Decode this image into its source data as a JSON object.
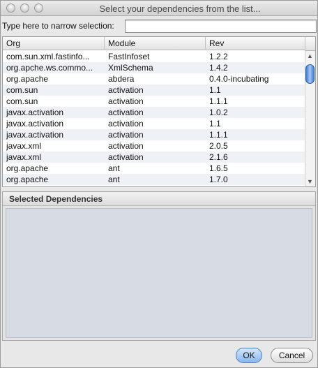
{
  "window": {
    "title": "Select your dependencies from the list..."
  },
  "filter": {
    "label": "Type here to narrow selection:",
    "value": "",
    "placeholder": ""
  },
  "table": {
    "columns": [
      "Org",
      "Module",
      "Rev"
    ],
    "rows": [
      [
        "com.sun.xml.fastinfo...",
        "FastInfoset",
        "1.2.2"
      ],
      [
        "org.apche.ws.commo...",
        "XmlSchema",
        "1.4.2"
      ],
      [
        "org.apache",
        "abdera",
        "0.4.0-incubating"
      ],
      [
        "com.sun",
        "activation",
        "1.1"
      ],
      [
        "com.sun",
        "activation",
        "1.1.1"
      ],
      [
        "javax.activation",
        "activation",
        "1.0.2"
      ],
      [
        "javax.activation",
        "activation",
        "1.1"
      ],
      [
        "javax.activation",
        "activation",
        "1.1.1"
      ],
      [
        "javax.xml",
        "activation",
        "2.0.5"
      ],
      [
        "javax.xml",
        "activation",
        "2.1.6"
      ],
      [
        "org.apache",
        "ant",
        "1.6.5"
      ],
      [
        "org.apache",
        "ant",
        "1.7.0"
      ]
    ]
  },
  "selected": {
    "header": "Selected Dependencies"
  },
  "buttons": {
    "ok": "OK",
    "cancel": "Cancel"
  },
  "icons": {
    "scroll_up": "arrow-up-icon",
    "scroll_down": "arrow-down-icon"
  }
}
